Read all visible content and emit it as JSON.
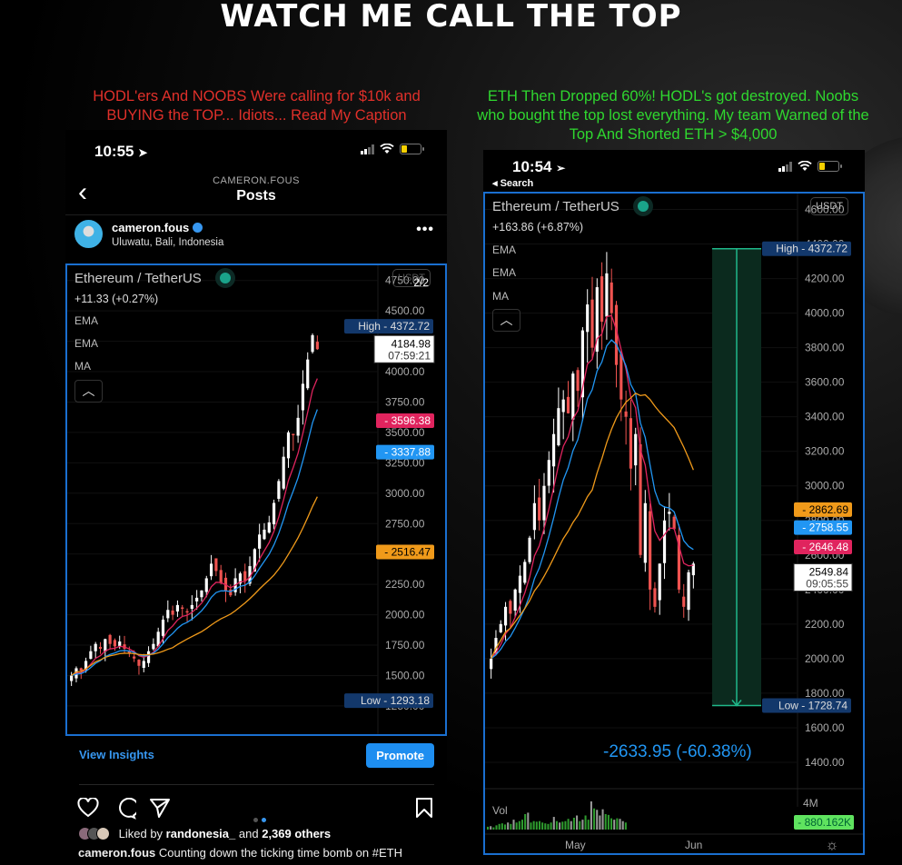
{
  "headline": "WATCH ME CALL THE TOP",
  "captions": {
    "left": "HODL'ers And NOOBS Were calling for $10k and BUYING the TOP... Idiots... Read My Caption",
    "right": "ETH Then Dropped 60%! HODL's got destroyed. Noobs who bought the top lost everything. My team Warned of the Top And Shorted ETH > $4,000"
  },
  "colors": {
    "caption_left": "#e0302a",
    "caption_right": "#2fd82f",
    "ema_fast": "#e0245e",
    "ema_slow": "#2196f3",
    "ma": "#f09a1a",
    "bull": "#ffffff",
    "bear": "#ef5350",
    "frame": "#1a6fd0",
    "tag_high_low": "#13386b",
    "range_fill": "#0b2a1e",
    "range_line": "#1fb88a",
    "measure_text": "#2196f3",
    "vol_up": "#2e9b2e",
    "vol_down": "#9a9a9a",
    "vol_tag": "#5fe35f"
  },
  "left_phone": {
    "status": {
      "time": "10:55",
      "location_icon": "location-arrow-icon"
    },
    "nav": {
      "subtitle": "CAMERON.FOUS",
      "title": "Posts"
    },
    "post": {
      "username": "cameron.fous",
      "location": "Uluwatu, Bali, Indonesia",
      "more_icon": "more-dots-icon"
    },
    "chart": {
      "symbol": "Ethereum / TetherUS",
      "change": "+11.33 (+0.27%)",
      "indicators": [
        "EMA",
        "EMA",
        "MA"
      ],
      "currency_badge": "USDT",
      "pager": "2/2"
    },
    "actions": {
      "insights": "View Insights",
      "promote": "Promote",
      "liked_by_prefix": "Liked by",
      "liked_by_user": "randonesia_",
      "liked_by_mid": "and",
      "liked_by_count": "2,369 others",
      "caption_user": "cameron.fous",
      "caption_text": "Counting down the ticking time bomb on #ETH"
    }
  },
  "right_phone": {
    "status": {
      "time": "10:54",
      "back_label": "◂ Search"
    },
    "chart": {
      "symbol": "Ethereum / TetherUS",
      "change": "+163.86 (+6.87%)",
      "indicators": [
        "EMA",
        "EMA",
        "MA"
      ],
      "currency_badge": "USDT"
    }
  },
  "chart_data": [
    {
      "type": "candlestick",
      "title": "Ethereum / TetherUS",
      "change": "+11.33 (+0.27%)",
      "yticks": [
        "4750.00",
        "4500.00",
        "4250.00",
        "4000.00",
        "3750.00",
        "3500.00",
        "3250.00",
        "3000.00",
        "2750.00",
        "2500.00",
        "2250.00",
        "2000.00",
        "1750.00",
        "1500.00",
        "1250.00"
      ],
      "ylim": [
        1100,
        4800
      ],
      "high": {
        "label": "High",
        "value": "4372.72"
      },
      "low": {
        "label": "Low",
        "value": "1293.18"
      },
      "last_price": {
        "value": "4184.98",
        "countdown": "07:59:21"
      },
      "indicator_tags": [
        {
          "name": "EMA fast",
          "value": "3596.38",
          "color": "#e0245e"
        },
        {
          "name": "EMA slow",
          "value": "3337.88",
          "color": "#2196f3"
        },
        {
          "name": "MA",
          "value": "2516.47",
          "color": "#f09a1a"
        }
      ],
      "closes": [
        1500,
        1560,
        1540,
        1620,
        1700,
        1760,
        1720,
        1800,
        1760,
        1740,
        1780,
        1720,
        1680,
        1640,
        1580,
        1620,
        1700,
        1760,
        1860,
        1960,
        2040,
        2000,
        2080,
        2060,
        2020,
        2080,
        2140,
        2200,
        2300,
        2420,
        2360,
        2260,
        2200,
        2160,
        2300,
        2340,
        2280,
        2400,
        2540,
        2660,
        2700,
        2760,
        2920,
        3100,
        3300,
        3500,
        3480,
        3620,
        3900,
        4100,
        4300,
        4185
      ]
    },
    {
      "type": "candlestick",
      "title": "Ethereum / TetherUS",
      "change": "+163.86 (+6.87%)",
      "yticks": [
        "4600.00",
        "4400.00",
        "4200.00",
        "4000.00",
        "3800.00",
        "3600.00",
        "3400.00",
        "3200.00",
        "3000.00",
        "2800.00",
        "2600.00",
        "2400.00",
        "2200.00",
        "2000.00",
        "1800.00",
        "1600.00",
        "1400.00"
      ],
      "ylim": [
        1300,
        4650
      ],
      "xticks": [
        "May",
        "Jun"
      ],
      "high": {
        "label": "High",
        "value": "4372.72"
      },
      "low": {
        "label": "Low",
        "value": "1728.74"
      },
      "last_price": {
        "value": "2549.84",
        "countdown": "09:05:55"
      },
      "indicator_tags": [
        {
          "name": "MA",
          "value": "2862.69",
          "color": "#f09a1a"
        },
        {
          "name": "EMA slow",
          "value": "2758.55",
          "color": "#2196f3"
        },
        {
          "name": "EMA fast",
          "value": "2646.48",
          "color": "#e0245e"
        }
      ],
      "measure": {
        "change": "-2633.95",
        "percent": "-60.38%",
        "label": "-2633.95 (-60.38%)"
      },
      "closes": [
        2000,
        2120,
        2200,
        2300,
        2260,
        2400,
        2480,
        2560,
        2700,
        2900,
        2800,
        3000,
        3150,
        3300,
        3450,
        3500,
        3420,
        3650,
        3550,
        3900,
        4050,
        3800,
        4150,
        3950,
        4230,
        4000,
        3700,
        3500,
        3400,
        3100,
        3300,
        2600,
        2900,
        2400,
        2300,
        2550,
        2800,
        2850,
        2750,
        2400,
        2300,
        2500,
        2550
      ],
      "volume": {
        "label": "Vol",
        "axis_label": "4M",
        "last": "880.162K",
        "values": [
          0.1,
          0.12,
          0.08,
          0.15,
          0.2,
          0.22,
          0.18,
          0.25,
          0.2,
          0.35,
          0.25,
          0.3,
          0.35,
          0.55,
          0.6,
          0.25,
          0.3,
          0.28,
          0.3,
          0.25,
          0.22,
          0.2,
          0.25,
          0.45,
          0.3,
          0.25,
          0.28,
          0.3,
          0.38,
          0.3,
          0.42,
          0.5,
          0.3,
          0.35,
          0.5,
          0.35,
          1.0,
          0.75,
          0.7,
          0.5,
          0.72,
          0.55,
          0.52,
          0.4,
          0.35,
          0.4,
          0.38,
          0.3,
          0.25
        ],
        "up": [
          1,
          0,
          1,
          1,
          1,
          1,
          1,
          0,
          1,
          0,
          1,
          1,
          1,
          1,
          0,
          1,
          1,
          1,
          1,
          1,
          1,
          1,
          1,
          0,
          1,
          0,
          1,
          1,
          1,
          0,
          1,
          0,
          1,
          0,
          1,
          1,
          0,
          1,
          0,
          0,
          0,
          1,
          1,
          1,
          0,
          1,
          0,
          0,
          1
        ]
      }
    }
  ]
}
